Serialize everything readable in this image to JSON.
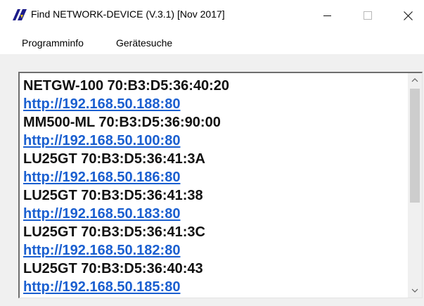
{
  "window": {
    "title": "Find NETWORK-DEVICE (V.3.1) [Nov 2017]",
    "icon": "app-icon"
  },
  "menu": {
    "items": [
      "Programminfo",
      "Gerätesuche"
    ]
  },
  "devices": {
    "lines": [
      {
        "text": "NETGW-100 70:B3:D5:36:40:20",
        "type": "device"
      },
      {
        "text": "http://192.168.50.188:80",
        "type": "link"
      },
      {
        "text": "MM500-ML 70:B3:D5:36:90:00",
        "type": "device"
      },
      {
        "text": "http://192.168.50.100:80",
        "type": "link"
      },
      {
        "text": "LU25GT 70:B3:D5:36:41:3A",
        "type": "device"
      },
      {
        "text": "http://192.168.50.186:80",
        "type": "link"
      },
      {
        "text": "LU25GT 70:B3:D5:36:41:38",
        "type": "device"
      },
      {
        "text": "http://192.168.50.183:80",
        "type": "link"
      },
      {
        "text": "LU25GT 70:B3:D5:36:41:3C",
        "type": "device"
      },
      {
        "text": "http://192.168.50.182:80",
        "type": "link"
      },
      {
        "text": "LU25GT 70:B3:D5:36:40:43",
        "type": "device"
      },
      {
        "text": "http://192.168.50.185:80",
        "type": "link"
      }
    ]
  },
  "colors": {
    "link": "#1a5fd0",
    "text": "#111111",
    "client_bg": "#f0f0f0"
  }
}
